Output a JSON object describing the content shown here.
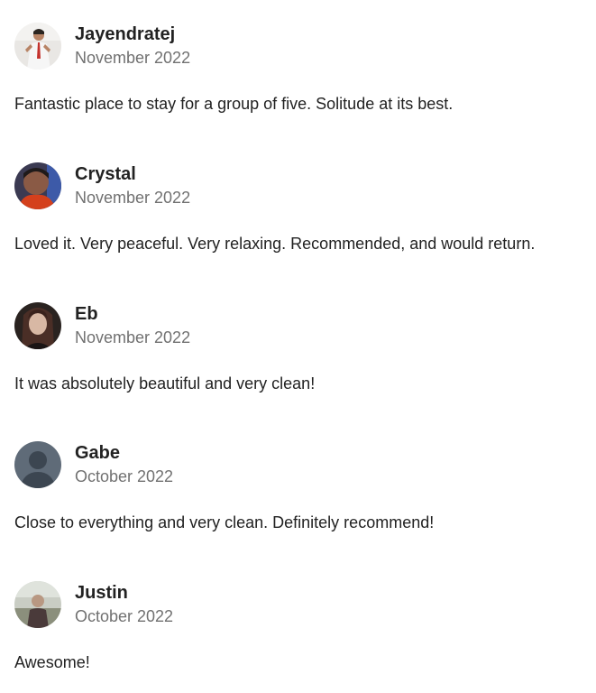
{
  "reviews": [
    {
      "name": "Jayendratej",
      "date": "November 2022",
      "comment": "Fantastic place to stay for a group of five. Solitude at its best.",
      "avatar_icon": "user-photo-avatar"
    },
    {
      "name": "Crystal",
      "date": "November 2022",
      "comment": "Loved it. Very peaceful. Very relaxing. Recommended, and would return.",
      "avatar_icon": "user-photo-avatar"
    },
    {
      "name": "Eb",
      "date": "November 2022",
      "comment": "It was absolutely beautiful and very clean!",
      "avatar_icon": "user-photo-avatar"
    },
    {
      "name": "Gabe",
      "date": "October 2022",
      "comment": "Close to everything and very clean. Definitely recommend!",
      "avatar_icon": "default-user-avatar-icon"
    },
    {
      "name": "Justin",
      "date": "October 2022",
      "comment": "Awesome!",
      "avatar_icon": "user-photo-avatar"
    }
  ],
  "colors": {
    "text_primary": "#222222",
    "text_secondary": "#717171",
    "default_avatar_bg": "#5f6b78"
  }
}
